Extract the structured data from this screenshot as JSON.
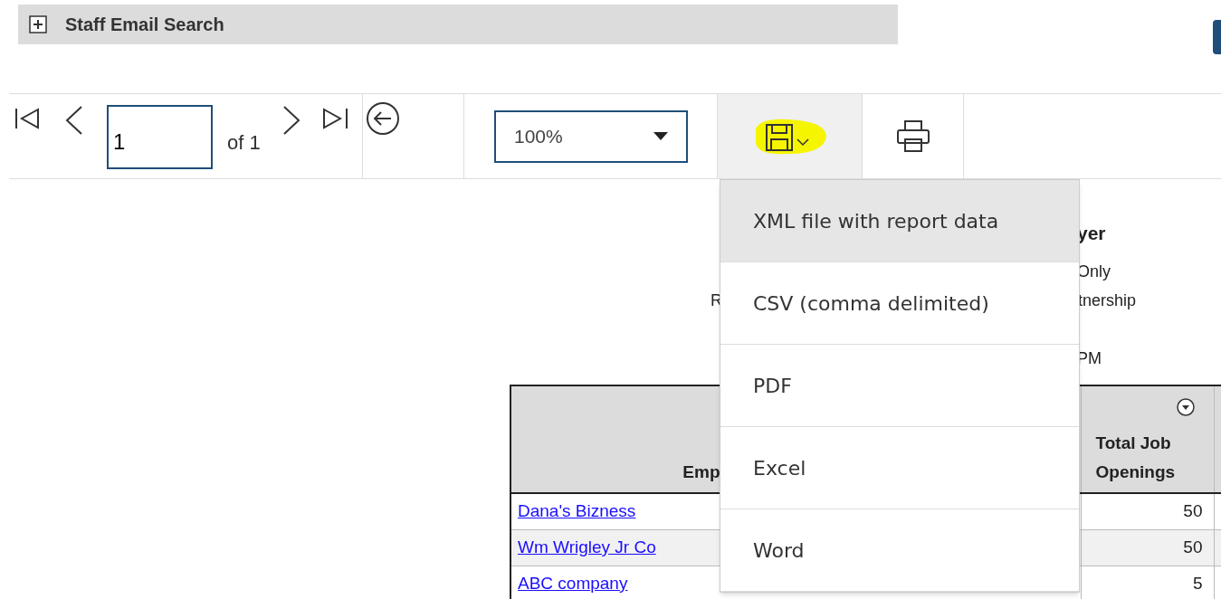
{
  "header": {
    "title": "Staff Email Search",
    "expanded": false
  },
  "toolbar": {
    "page": "1",
    "page_count": "of 1",
    "zoom": "100%",
    "export_open": true
  },
  "export_menu": [
    {
      "label": "XML file with report data",
      "selected": true
    },
    {
      "label": "CSV (comma delimited)",
      "selected": false
    },
    {
      "label": "PDF",
      "selected": false
    },
    {
      "label": "Excel",
      "selected": false
    },
    {
      "label": "Word",
      "selected": false
    }
  ],
  "report": {
    "title": "yer",
    "left_label": "R",
    "lines": [
      "Only",
      "tnership"
    ],
    "timestamp": "PM"
  },
  "table": {
    "columns": [
      "Emp",
      "Total Job Openings"
    ],
    "rows": [
      {
        "employer": "Dana's Bizness",
        "total": "50"
      },
      {
        "employer": "Wm Wrigley Jr Co",
        "total": "50"
      },
      {
        "employer": "ABC company",
        "total": "5"
      }
    ]
  }
}
